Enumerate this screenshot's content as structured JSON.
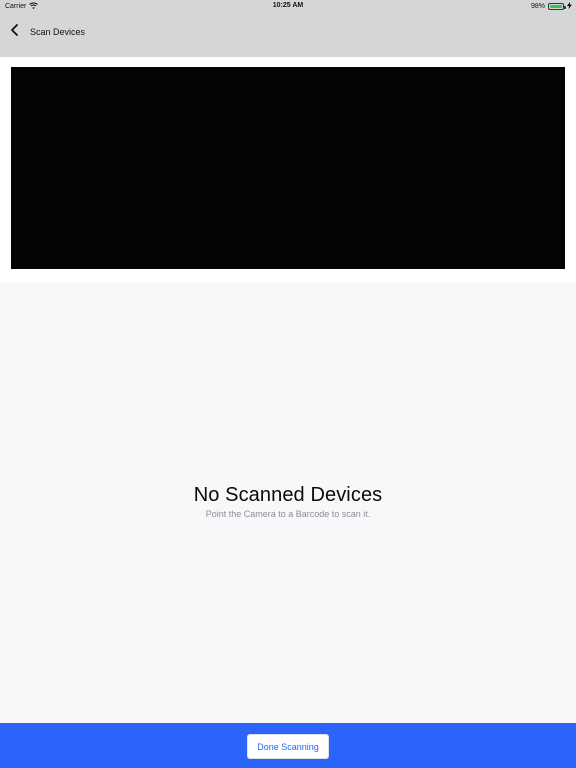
{
  "status_bar": {
    "carrier": "Carrier",
    "time": "10:25 AM",
    "battery_percent_label": "98%",
    "battery_level": 0.98,
    "wifi_icon": "wifi-icon",
    "charging_icon": "bolt-icon"
  },
  "nav": {
    "back_icon": "chevron-left-icon",
    "title": "Scan Devices"
  },
  "camera": {
    "state": "preview"
  },
  "empty_state": {
    "title": "No Scanned Devices",
    "subtitle": "Point the Camera to a Barcode to scan it."
  },
  "footer": {
    "done_label": "Done Scanning",
    "accent_color": "#2a64fb"
  }
}
